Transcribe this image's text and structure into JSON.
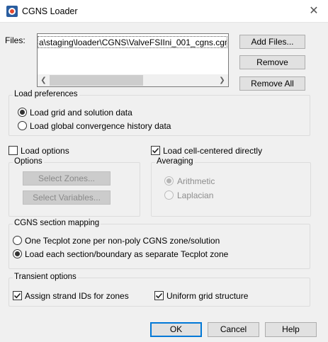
{
  "window": {
    "title": "CGNS Loader"
  },
  "files": {
    "label": "Files:",
    "items": [
      "a\\staging\\loader\\CGNS\\ValveFSIIni_001_cgns.cgns"
    ],
    "add_button": "Add Files...",
    "remove_button": "Remove",
    "remove_all_button": "Remove All"
  },
  "load_preferences": {
    "title": "Load preferences",
    "options": [
      {
        "label": "Load grid and solution data",
        "checked": true
      },
      {
        "label": "Load global convergence history data",
        "checked": false
      }
    ]
  },
  "load_options": {
    "label": "Load options",
    "checked": false,
    "options_group": {
      "title": "Options",
      "select_zones": "Select Zones...",
      "select_variables": "Select Variables..."
    }
  },
  "cell_centered": {
    "label": "Load cell-centered directly",
    "checked": true,
    "averaging": {
      "title": "Averaging",
      "options": [
        {
          "label": "Arithmetic",
          "checked": true
        },
        {
          "label": "Laplacian",
          "checked": false
        }
      ]
    }
  },
  "section_mapping": {
    "title": "CGNS section mapping",
    "options": [
      {
        "label": "One Tecplot zone per non-poly CGNS zone/solution",
        "checked": false
      },
      {
        "label": "Load each section/boundary as separate Tecplot zone",
        "checked": true
      }
    ]
  },
  "transient": {
    "title": "Transient options",
    "strand_ids": {
      "label": "Assign strand IDs for zones",
      "checked": true
    },
    "uniform_grid": {
      "label": "Uniform grid structure",
      "checked": true
    }
  },
  "footer": {
    "ok": "OK",
    "cancel": "Cancel",
    "help": "Help"
  },
  "colors": {
    "accent": "#0078d7",
    "disabled_text": "#8d8d8d"
  }
}
